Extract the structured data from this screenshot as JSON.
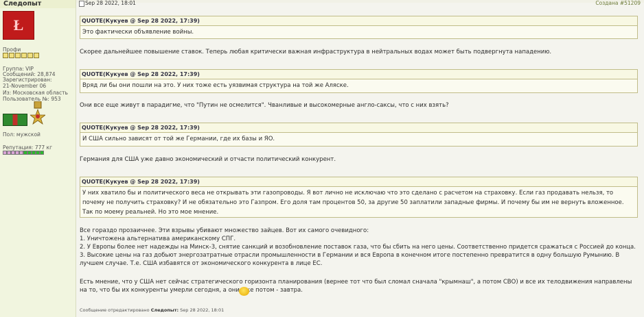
{
  "user": {
    "name": "Следопыт",
    "rank_label": "Профи",
    "group": "Группа: VIP",
    "posts": "Сообщений: 28,874",
    "registered": "Зарегистрирован: 21-November 06",
    "from": "Из: Московская область",
    "user_no": "Пользователь №: 953",
    "gender": "Пол: мужской",
    "reputation": "Репутация: 777 кг"
  },
  "post": {
    "date": "Sep 28 2022, 18:01",
    "created": "Создана #51209",
    "quotes": [
      {
        "header": "QUOTE(Кукуев @ Sep 28 2022, 17:39)",
        "body": "Это фактически объявление войны."
      },
      {
        "header": "QUOTE(Кукуев @ Sep 28 2022, 17:39)",
        "body": "Вряд ли бы они пошли на это. У них тоже есть уязвимая структура на той же Аляске."
      },
      {
        "header": "QUOTE(Кукуев @ Sep 28 2022, 17:39)",
        "body": "И США сильно зависят от той же Германии, где их базы и ЯО."
      },
      {
        "header": "QUOTE(Кукуев @ Sep 28 2022, 17:39)",
        "body": "У них хватило бы и политического веса не открывать эти газопроводы. Я вот лично не исключаю что это сделано с расчетом на страховку. Если газ продавать нельзя, то почему не получить страховку? И не обязательно это Газпром. Его доля там процентов 50, за другие 50 заплатили западные фирмы. И почему бы им не вернуть вложенное. Так по моему реальней. Но это мое мнение."
      }
    ],
    "replies": [
      "Скорее дальнейшее повышение ставок. Теперь любая критически важная инфраструктура в нейтральных водах может быть подвергнута нападению.",
      "Они все еще живут в парадигме, что \"Путин не осмелится\". Чванливые и высокомерные англо-саксы, что с них взять?",
      "Германия для США уже давно экономический и отчасти политический конкурент.",
      "Все гораздо прозаичнее. Эти взрывы убивают множество зайцев. Вот их самого очевидного:",
      "1. Уничтожена альтернатива американскому СПГ.",
      "2. У Европы более нет надежды на Минск-3, снятие санкций и возобновление поставок газа, что бы сбить на него цены. Соответственно придется сражаться с Россией до конца.",
      "3. Высокие цены на газ добьют энергозатратные отрасли промышленности в Германии и вся Европа в конечном итоге постепенно превратится в одну большую Румынию. В лучшем случае. Т.е. США избавятся от экономического конкурента в лице ЕС.",
      "Есть мнение, что у США нет сейчас стратегического горизонта планирования (вернее тот что был сломал сначала \"крымнаш\", а потом СВО) и все их телодвижения направлены на то, что бы их конкуренты умерли сегодня, а они уже потом - завтра."
    ],
    "edited_prefix": "Сообщение отредактировано",
    "edited_by": "Следопыт:",
    "edited_date": "Sep 28 2022, 18:01"
  },
  "colors": {
    "accent": "#6e7c3a",
    "quote_border": "#c0bc88"
  }
}
